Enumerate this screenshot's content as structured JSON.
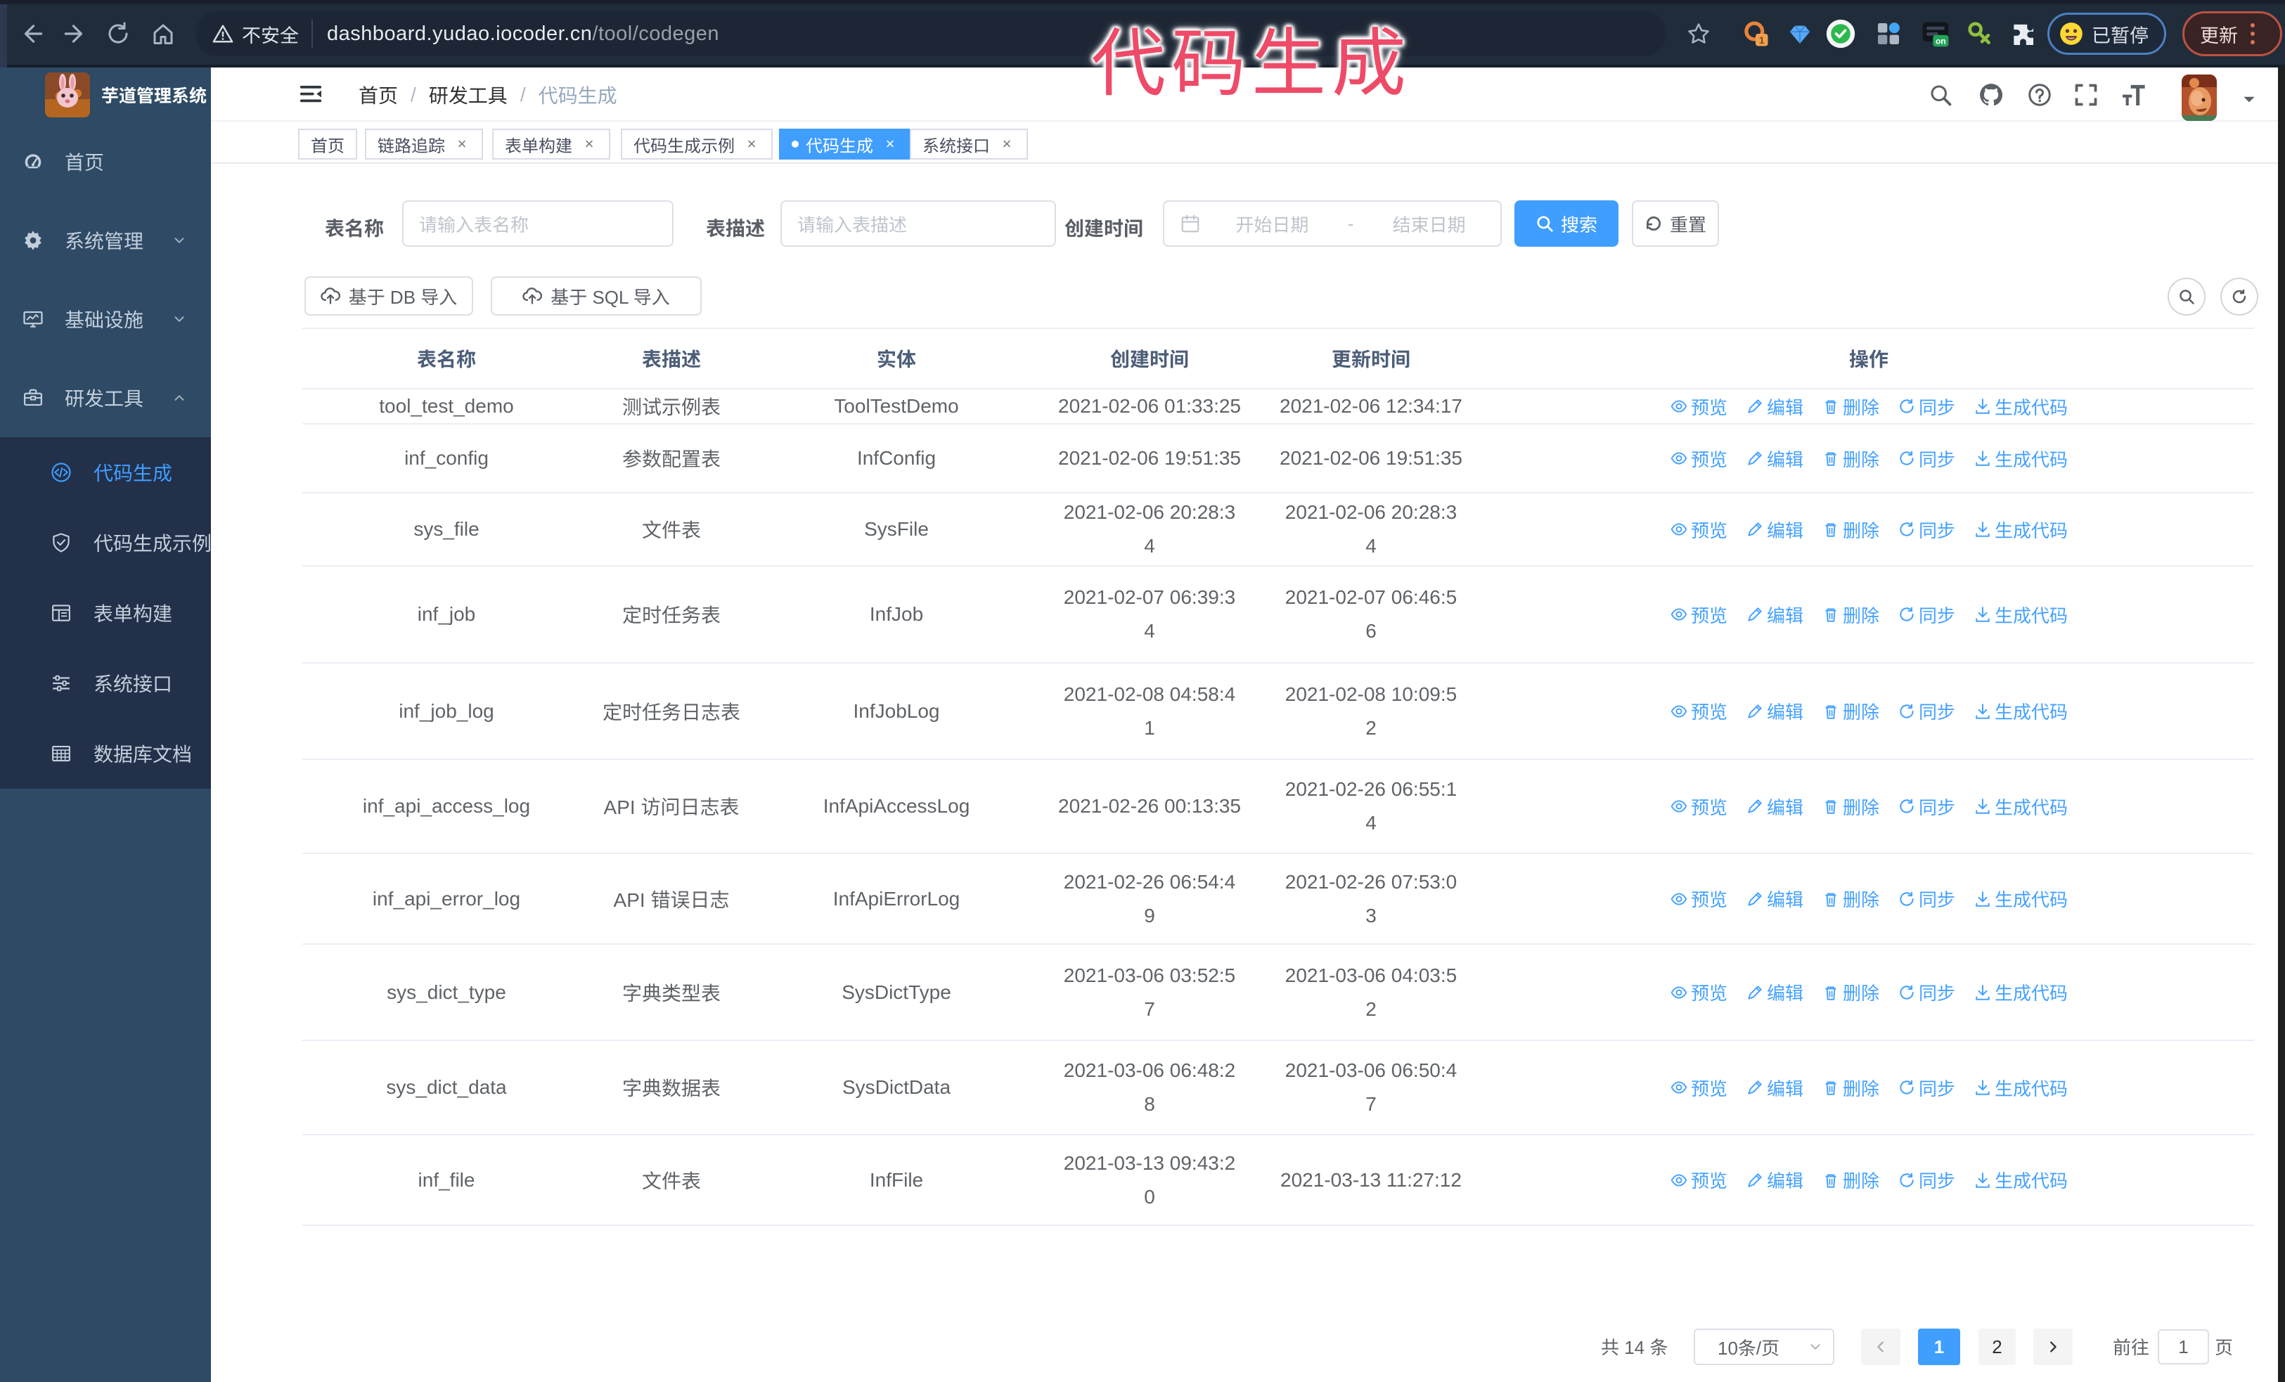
{
  "browser": {
    "security_label": "不安全",
    "url_host": "dashboard.yudao.iocoder.cn",
    "url_path": "/tool/codegen",
    "paused_badge": "已暂停",
    "update_button": "更新"
  },
  "annotation": {
    "text": "代码生成",
    "color": "#ee4b68"
  },
  "sidebar": {
    "logo_title": "芋道管理系统",
    "menu": [
      {
        "id": "home",
        "label": "首页",
        "icon": "dashboard-icon"
      },
      {
        "id": "system-management",
        "label": "系统管理",
        "icon": "gear-icon",
        "arrow": "down"
      },
      {
        "id": "infrastructure",
        "label": "基础设施",
        "icon": "monitor-icon",
        "arrow": "down"
      },
      {
        "id": "dev-tools",
        "label": "研发工具",
        "icon": "toolbox-icon",
        "arrow": "up",
        "expanded": true
      }
    ],
    "submenu": [
      {
        "id": "codegen",
        "label": "代码生成",
        "icon": "code-icon",
        "active": true
      },
      {
        "id": "codegen-demo",
        "label": "代码生成示例",
        "icon": "shield-check-icon"
      },
      {
        "id": "form-builder",
        "label": "表单构建",
        "icon": "form-icon"
      },
      {
        "id": "system-api",
        "label": "系统接口",
        "icon": "sliders-icon"
      },
      {
        "id": "db-doc",
        "label": "数据库文档",
        "icon": "table-grid-icon"
      }
    ]
  },
  "navbar": {
    "breadcrumb": [
      "首页",
      "研发工具",
      "代码生成"
    ]
  },
  "tabs": [
    {
      "id": "home",
      "label": "首页",
      "closable": false
    },
    {
      "id": "trace",
      "label": "链路追踪",
      "closable": true
    },
    {
      "id": "form-builder",
      "label": "表单构建",
      "closable": true
    },
    {
      "id": "codegen-demo",
      "label": "代码生成示例",
      "closable": true
    },
    {
      "id": "codegen",
      "label": "代码生成",
      "closable": true,
      "active": true
    },
    {
      "id": "system-api",
      "label": "系统接口",
      "closable": true
    }
  ],
  "search_form": {
    "table_name_label": "表名称",
    "table_name_placeholder": "请输入表名称",
    "table_desc_label": "表描述",
    "table_desc_placeholder": "请输入表描述",
    "create_time_label": "创建时间",
    "date_start_placeholder": "开始日期",
    "date_separator": "-",
    "date_end_placeholder": "结束日期",
    "search_button": "搜索",
    "reset_button": "重置"
  },
  "toolbar": {
    "import_db_button": "基于 DB 导入",
    "import_sql_button": "基于 SQL 导入"
  },
  "table": {
    "columns": [
      "表名称",
      "表描述",
      "实体",
      "创建时间",
      "更新时间",
      "操作"
    ],
    "row_actions": [
      "预览",
      "编辑",
      "删除",
      "同步",
      "生成代码"
    ],
    "rows": [
      {
        "name": "tool_test_demo",
        "desc": "测试示例表",
        "entity": "ToolTestDemo",
        "create_time": [
          "2021-02-06 01:33:25"
        ],
        "update_time": [
          "2021-02-06 12:34:17"
        ]
      },
      {
        "name": "inf_config",
        "desc": "参数配置表",
        "entity": "InfConfig",
        "create_time": [
          "2021-02-06 19:51:35"
        ],
        "update_time": [
          "2021-02-06 19:51:35"
        ]
      },
      {
        "name": "sys_file",
        "desc": "文件表",
        "entity": "SysFile",
        "create_time": [
          "2021-02-06 20:28:3",
          "4"
        ],
        "update_time": [
          "2021-02-06 20:28:3",
          "4"
        ]
      },
      {
        "name": "inf_job",
        "desc": "定时任务表",
        "entity": "InfJob",
        "create_time": [
          "2021-02-07 06:39:3",
          "4"
        ],
        "update_time": [
          "2021-02-07 06:46:5",
          "6"
        ]
      },
      {
        "name": "inf_job_log",
        "desc": "定时任务日志表",
        "entity": "InfJobLog",
        "create_time": [
          "2021-02-08 04:58:4",
          "1"
        ],
        "update_time": [
          "2021-02-08 10:09:5",
          "2"
        ]
      },
      {
        "name": "inf_api_access_log",
        "desc": "API 访问日志表",
        "entity": "InfApiAccessLog",
        "create_time": [
          "2021-02-26 00:13:35"
        ],
        "update_time": [
          "2021-02-26 06:55:1",
          "4"
        ]
      },
      {
        "name": "inf_api_error_log",
        "desc": "API 错误日志",
        "entity": "InfApiErrorLog",
        "create_time": [
          "2021-02-26 06:54:4",
          "9"
        ],
        "update_time": [
          "2021-02-26 07:53:0",
          "3"
        ]
      },
      {
        "name": "sys_dict_type",
        "desc": "字典类型表",
        "entity": "SysDictType",
        "create_time": [
          "2021-03-06 03:52:5",
          "7"
        ],
        "update_time": [
          "2021-03-06 04:03:5",
          "2"
        ]
      },
      {
        "name": "sys_dict_data",
        "desc": "字典数据表",
        "entity": "SysDictData",
        "create_time": [
          "2021-03-06 06:48:2",
          "8"
        ],
        "update_time": [
          "2021-03-06 06:50:4",
          "7"
        ]
      },
      {
        "name": "inf_file",
        "desc": "文件表",
        "entity": "InfFile",
        "create_time": [
          "2021-03-13 09:43:2",
          "0"
        ],
        "update_time": [
          "2021-03-13 11:27:12"
        ]
      }
    ]
  },
  "pagination": {
    "total_label": "共 14 条",
    "page_size": "10条/页",
    "pages": [
      "1",
      "2"
    ],
    "active_page": "1",
    "goto_label": "前往",
    "goto_value": "1",
    "goto_unit": "页"
  },
  "colors": {
    "accent": "#409eff",
    "sidebar_bg": "#2d4660",
    "submenu_bg": "#22304a",
    "annotation": "#ee4b68"
  }
}
